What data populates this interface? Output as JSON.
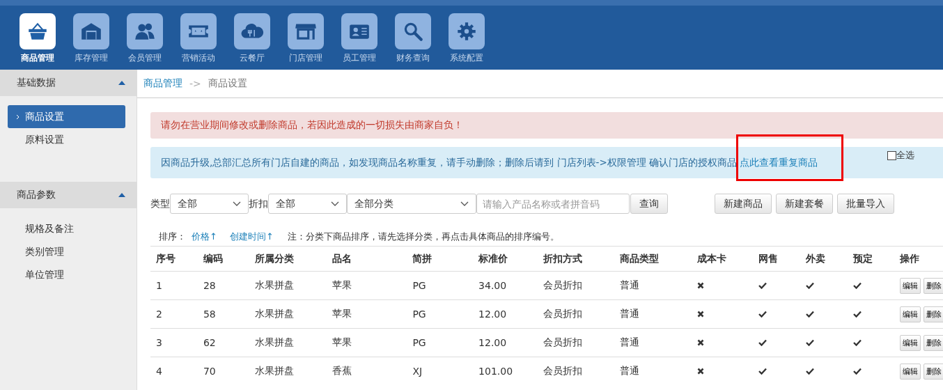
{
  "top_nav": [
    {
      "label": "商品管理",
      "selected": true
    },
    {
      "label": "库存管理",
      "selected": false
    },
    {
      "label": "会员管理",
      "selected": false
    },
    {
      "label": "营销活动",
      "selected": false
    },
    {
      "label": "云餐厅",
      "selected": false
    },
    {
      "label": "门店管理",
      "selected": false
    },
    {
      "label": "员工管理",
      "selected": false
    },
    {
      "label": "财务查询",
      "selected": false
    },
    {
      "label": "系统配置",
      "selected": false
    }
  ],
  "sidebar": {
    "sections": [
      {
        "title": "基础数据",
        "expanded": true,
        "items": [
          {
            "label": "商品设置",
            "selected": true
          },
          {
            "label": "原料设置",
            "selected": false
          }
        ]
      },
      {
        "title": "商品参数",
        "expanded": true,
        "items": [
          {
            "label": "规格及备注",
            "selected": false
          },
          {
            "label": "类别管理",
            "selected": false
          },
          {
            "label": "单位管理",
            "selected": false
          }
        ]
      }
    ]
  },
  "breadcrumb": {
    "parent": "商品管理",
    "separator": "->",
    "current": "商品设置"
  },
  "warning_alert": "请勿在营业期间修改或删除商品，若因此造成的一切损失由商家自负！",
  "info_alert": {
    "text": "因商品升级,总部汇总所有门店自建的商品，如发现商品名称重复，请手动删除；删除后请到 门店列表->权限管理 确认门店的授权商品",
    "link": "点此查看重复商品",
    "highlighted": true
  },
  "select_all": {
    "label": "全选",
    "checked": false
  },
  "filters": {
    "type_label": "类型",
    "type_value": "全部",
    "discount_label": "折扣",
    "discount_value": "全部",
    "category_value": "全部分类",
    "search": {
      "placeholder": "请输入产品名称或者拼音码"
    },
    "query_button": "查询"
  },
  "actions": [
    "新建商品",
    "新建套餐",
    "批量导入"
  ],
  "sort": {
    "label": "排序：",
    "options": [
      "价格↑",
      "创建时间↑"
    ],
    "note": "注：分类下商品排序，请先选择分类，再点击具体商品的排序编号。"
  },
  "table": {
    "columns": [
      "序号",
      "编码",
      "所属分类",
      "品名",
      "简拼",
      "标准价",
      "折扣方式",
      "商品类型",
      "成本卡",
      "网售",
      "外卖",
      "预定",
      "操作"
    ],
    "rows": [
      {
        "no": "1",
        "code": "28",
        "category": "水果拼盘",
        "name": "苹果",
        "abbr": "PG",
        "price": "34.00",
        "discount": "会员折扣",
        "type": "普通",
        "cost_card": false,
        "online": true,
        "takeout": true,
        "reserve": true,
        "buttons": [
          "编辑",
          "删除"
        ]
      },
      {
        "no": "2",
        "code": "58",
        "category": "水果拼盘",
        "name": "苹果",
        "abbr": "PG",
        "price": "12.00",
        "discount": "会员折扣",
        "type": "普通",
        "cost_card": false,
        "online": true,
        "takeout": true,
        "reserve": true,
        "buttons": [
          "编辑",
          "删除"
        ]
      },
      {
        "no": "3",
        "code": "62",
        "category": "水果拼盘",
        "name": "苹果",
        "abbr": "PG",
        "price": "12.00",
        "discount": "会员折扣",
        "type": "普通",
        "cost_card": false,
        "online": true,
        "takeout": true,
        "reserve": true,
        "buttons": [
          "编辑",
          "删除"
        ]
      },
      {
        "no": "4",
        "code": "70",
        "category": "水果拼盘",
        "name": "香蕉",
        "abbr": "XJ",
        "price": "101.00",
        "discount": "会员折扣",
        "type": "普通",
        "cost_card": false,
        "online": true,
        "takeout": true,
        "reserve": true,
        "buttons": [
          "编辑",
          "删除"
        ]
      }
    ]
  }
}
